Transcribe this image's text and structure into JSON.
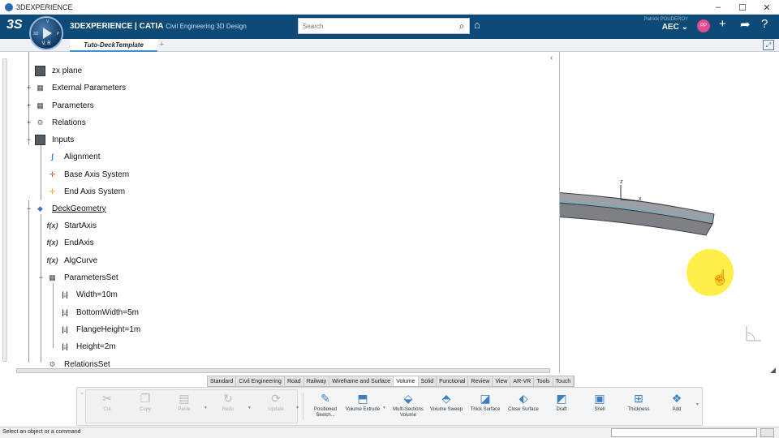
{
  "window": {
    "title": "3DEXPERIENCE",
    "controls": {
      "minimize": "–",
      "maximize": "☐",
      "close": "✕"
    }
  },
  "header": {
    "logo": "3S",
    "compass_quadrants": [
      "3D",
      "V",
      "P",
      "R"
    ],
    "compass_version": "V, R",
    "brand_main": "3DEXPERIENCE | CATIA",
    "brand_sub": "Civil Engineering 3D Design",
    "search_placeholder": "Search",
    "search_icon": "magnifier-icon",
    "user_name": "Patrick POUDEROY",
    "workspace": "AEC",
    "avatar_initials": "PP",
    "icons": [
      "tag-icon",
      "plus-icon",
      "share-icon",
      "help-icon"
    ]
  },
  "tabs": {
    "active": "Tuto-DeckTemplate",
    "add": "+",
    "expand_icon": "maximize-icon"
  },
  "tree": {
    "items": [
      {
        "label": "zx plane",
        "icon": "plane-icon"
      },
      {
        "label": "External Parameters",
        "icon": "parameters-icon",
        "toggle": "+"
      },
      {
        "label": "Parameters",
        "icon": "parameters-icon",
        "toggle": "+"
      },
      {
        "label": "Relations",
        "icon": "relations-icon",
        "toggle": "+"
      },
      {
        "label": "Inputs",
        "icon": "inputs-icon",
        "toggle": "−"
      },
      {
        "label": "Alignment",
        "icon": "curve-icon"
      },
      {
        "label": "Base Axis System",
        "icon": "axis-system-icon"
      },
      {
        "label": "End Axis System",
        "icon": "axis-system-icon"
      },
      {
        "label": "DeckGeometry",
        "icon": "geometrical-set-icon",
        "toggle": "−"
      },
      {
        "label": "StartAxis",
        "icon": "formula-icon"
      },
      {
        "label": "EndAxis",
        "icon": "formula-icon"
      },
      {
        "label": "AlgCurve",
        "icon": "formula-icon"
      },
      {
        "label": "ParametersSet",
        "icon": "parameters-icon",
        "toggle": "−"
      },
      {
        "label": "Width=10m",
        "icon": "parameter-icon"
      },
      {
        "label": "BottomWidth=5m",
        "icon": "parameter-icon"
      },
      {
        "label": "FlangeHeight=1m",
        "icon": "parameter-icon"
      },
      {
        "label": "Height=2m",
        "icon": "parameter-icon"
      },
      {
        "label": "RelationsSet",
        "icon": "relations-icon"
      }
    ],
    "collapse_glyph": "‹"
  },
  "viewport": {
    "axis_labels": {
      "z": "z",
      "x": "x"
    },
    "cursor": "hand-cursor-icon",
    "highlight_color": "#ffe828"
  },
  "toolbar": {
    "tabs": [
      "Standard",
      "Civil Engineering",
      "Road",
      "Railway",
      "Wireframe and Surface",
      "Volume",
      "Solid",
      "Functional",
      "Review",
      "View",
      "AR-VR",
      "Tools",
      "Touch"
    ],
    "active_tab": "Volume",
    "tools": [
      {
        "label": "Cut",
        "icon": "cut-icon",
        "enabled": false
      },
      {
        "label": "Copy",
        "icon": "copy-icon",
        "enabled": false
      },
      {
        "label": "Paste",
        "icon": "paste-icon",
        "enabled": false
      },
      {
        "label": "Redo",
        "icon": "redo-icon",
        "enabled": false
      },
      {
        "label": "Update",
        "icon": "update-icon",
        "enabled": false
      },
      {
        "label": "Positioned Sketch...",
        "icon": "sketch-icon",
        "enabled": true
      },
      {
        "label": "Volume Extrude",
        "icon": "extrude-icon",
        "enabled": true
      },
      {
        "label": "Multi-Sections Volume",
        "icon": "multi-sections-icon",
        "enabled": true
      },
      {
        "label": "Volume Sweep",
        "icon": "sweep-icon",
        "enabled": true
      },
      {
        "label": "Thick Surface",
        "icon": "thick-surface-icon",
        "enabled": true
      },
      {
        "label": "Close Surface",
        "icon": "close-surface-icon",
        "enabled": true
      },
      {
        "label": "Draft",
        "icon": "draft-icon",
        "enabled": true
      },
      {
        "label": "Shell",
        "icon": "shell-icon",
        "enabled": true
      },
      {
        "label": "Thickness",
        "icon": "thickness-icon",
        "enabled": true
      },
      {
        "label": "Add",
        "icon": "add-icon",
        "enabled": true
      }
    ]
  },
  "status": {
    "message": "Select an object or a command"
  }
}
